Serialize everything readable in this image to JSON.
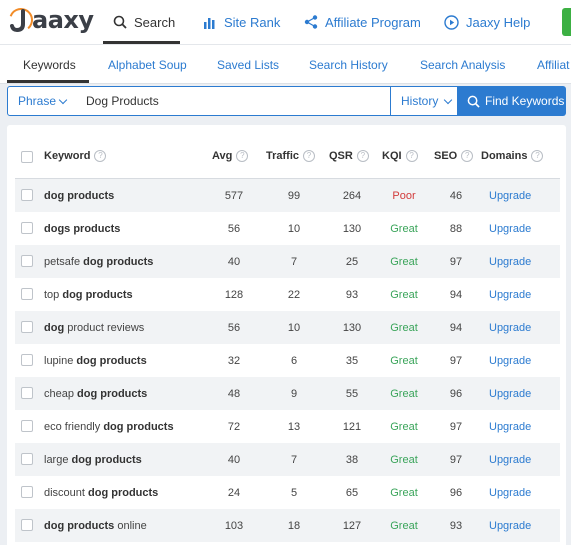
{
  "topnav": {
    "logo_text": "aaxy",
    "items": [
      {
        "label": "Search",
        "icon": "search-icon",
        "active": true
      },
      {
        "label": "Site Rank",
        "icon": "bar-chart-icon"
      },
      {
        "label": "Affiliate Program",
        "icon": "share-icon"
      },
      {
        "label": "Jaaxy Help",
        "icon": "play-circle-icon"
      }
    ],
    "accent": "#2c7bd0",
    "cta_color": "#3cb043"
  },
  "tabs": [
    {
      "label": "Keywords",
      "active": true
    },
    {
      "label": "Alphabet Soup"
    },
    {
      "label": "Saved Lists"
    },
    {
      "label": "Search History"
    },
    {
      "label": "Search Analysis"
    },
    {
      "label": "Affiliat"
    }
  ],
  "search": {
    "mode": "Phrase",
    "query": "Dog Products",
    "history_label": "History",
    "find_label": "Find Keywords"
  },
  "table": {
    "headers": {
      "keyword": "Keyword",
      "avg": "Avg",
      "traffic": "Traffic",
      "qsr": "QSR",
      "kqi": "KQI",
      "seo": "SEO",
      "domains": "Domains"
    },
    "rows": [
      {
        "kw": [
          [
            "dog products",
            true
          ]
        ],
        "avg": "577",
        "traffic": "99",
        "qsr": "264",
        "kqi": "Poor",
        "seo": "46",
        "domains": "Upgrade"
      },
      {
        "kw": [
          [
            "dogs products",
            true
          ]
        ],
        "avg": "56",
        "traffic": "10",
        "qsr": "130",
        "kqi": "Great",
        "seo": "88",
        "domains": "Upgrade"
      },
      {
        "kw": [
          [
            "petsafe ",
            false
          ],
          [
            "dog products",
            true
          ]
        ],
        "avg": "40",
        "traffic": "7",
        "qsr": "25",
        "kqi": "Great",
        "seo": "97",
        "domains": "Upgrade"
      },
      {
        "kw": [
          [
            "top ",
            false
          ],
          [
            "dog products",
            true
          ]
        ],
        "avg": "128",
        "traffic": "22",
        "qsr": "93",
        "kqi": "Great",
        "seo": "94",
        "domains": "Upgrade"
      },
      {
        "kw": [
          [
            "dog",
            true
          ],
          [
            " product reviews",
            false
          ]
        ],
        "avg": "56",
        "traffic": "10",
        "qsr": "130",
        "kqi": "Great",
        "seo": "94",
        "domains": "Upgrade"
      },
      {
        "kw": [
          [
            "lupine ",
            false
          ],
          [
            "dog products",
            true
          ]
        ],
        "avg": "32",
        "traffic": "6",
        "qsr": "35",
        "kqi": "Great",
        "seo": "97",
        "domains": "Upgrade"
      },
      {
        "kw": [
          [
            "cheap ",
            false
          ],
          [
            "dog products",
            true
          ]
        ],
        "avg": "48",
        "traffic": "9",
        "qsr": "55",
        "kqi": "Great",
        "seo": "96",
        "domains": "Upgrade"
      },
      {
        "kw": [
          [
            "eco friendly ",
            false
          ],
          [
            "dog products",
            true
          ]
        ],
        "avg": "72",
        "traffic": "13",
        "qsr": "121",
        "kqi": "Great",
        "seo": "97",
        "domains": "Upgrade"
      },
      {
        "kw": [
          [
            "large ",
            false
          ],
          [
            "dog products",
            true
          ]
        ],
        "avg": "40",
        "traffic": "7",
        "qsr": "38",
        "kqi": "Great",
        "seo": "97",
        "domains": "Upgrade"
      },
      {
        "kw": [
          [
            "discount ",
            false
          ],
          [
            "dog products",
            true
          ]
        ],
        "avg": "24",
        "traffic": "5",
        "qsr": "65",
        "kqi": "Great",
        "seo": "96",
        "domains": "Upgrade"
      },
      {
        "kw": [
          [
            "dog products",
            true
          ],
          [
            " online",
            false
          ]
        ],
        "avg": "103",
        "traffic": "18",
        "qsr": "127",
        "kqi": "Great",
        "seo": "93",
        "domains": "Upgrade"
      }
    ],
    "kqi_colors": {
      "Poor": "#d23b3b",
      "Great": "#3aa45a"
    }
  }
}
